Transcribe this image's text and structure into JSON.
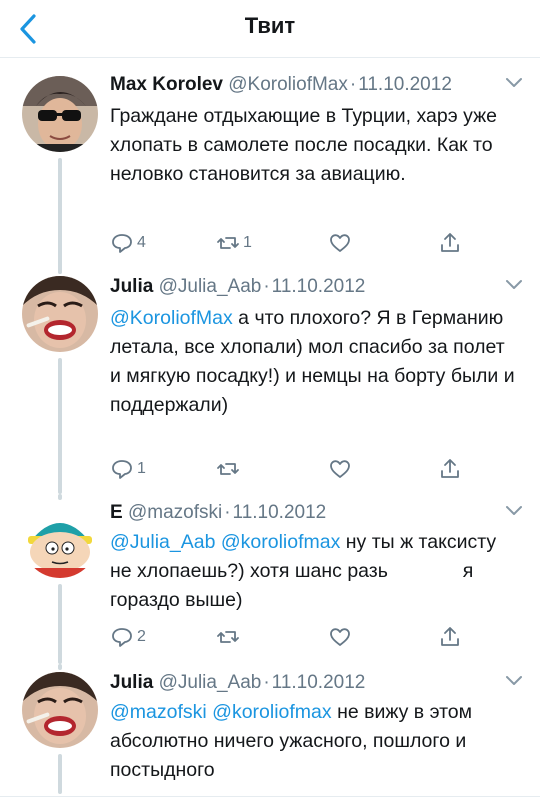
{
  "header": {
    "title": "Твит"
  },
  "tweets": [
    {
      "name": "Max Korolev",
      "handle": "@KoroliofMax",
      "date": "11.10.2012",
      "text": "Граждане отдыхающие в Турции, харэ уже хлопать в самолете после посадки. Как то неловко становится за авиацию.",
      "replies": "4",
      "retweets": "1",
      "likes": ""
    },
    {
      "name": "Julia",
      "handle": "@Julia_Aab",
      "date": "11.10.2012",
      "mentions": "@KoroliofMax",
      "text": " а что плохого? Я в Германию летала, все хлопали) мол спасибо за полет и мягкую посадку!) и немцы на борту были и поддержали)",
      "replies": "1",
      "retweets": "",
      "likes": ""
    },
    {
      "name": "E",
      "handle": "@mazofski",
      "date": "11.10.2012",
      "mentions": "@Julia_Aab @koroliofmax",
      "text_a": " ну ты ж таксисту не хлопаешь?) хотя шанс разь",
      "text_b": "я гораздо выше)",
      "replies": "2",
      "retweets": "",
      "likes": ""
    },
    {
      "name": "Julia",
      "handle": "@Julia_Aab",
      "date": "11.10.2012",
      "mentions": "@mazofski @koroliofmax",
      "text": " не вижу в этом абсолютно ничего ужасного, пошлого и постыдного"
    }
  ],
  "icons": {
    "back": "chevron-left-icon",
    "reply": "reply-icon",
    "retweet": "retweet-icon",
    "like": "heart-icon",
    "share": "share-icon",
    "more": "chevron-down-icon"
  },
  "colors": {
    "accent": "#1b95e0",
    "muted": "#657786",
    "text": "#14171a",
    "border": "#e6ecf0"
  }
}
